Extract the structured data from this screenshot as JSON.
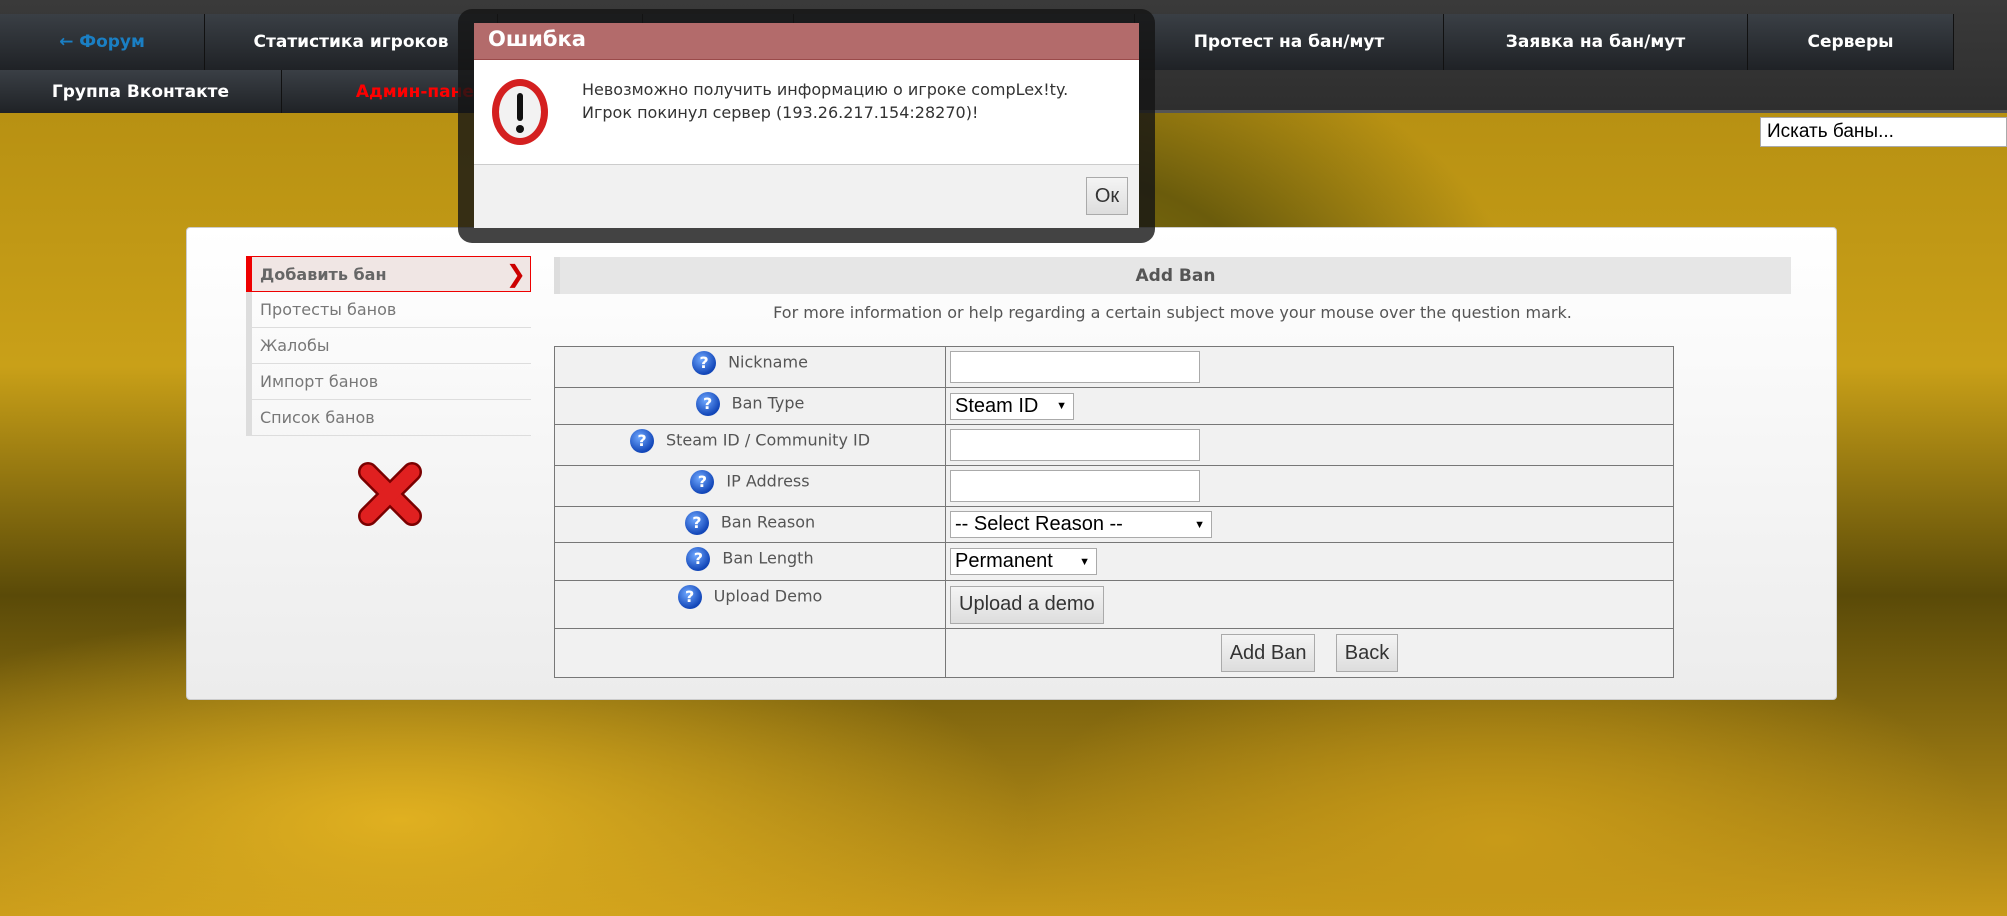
{
  "nav": {
    "row1": [
      {
        "label": "← Форум"
      },
      {
        "label": "Статистика игроков"
      },
      {
        "label": ""
      },
      {
        "label": ""
      },
      {
        "label": ""
      },
      {
        "label": "Протест на бан/мут"
      },
      {
        "label": "Заявка на бан/мут"
      },
      {
        "label": "Серверы"
      }
    ],
    "row2": [
      {
        "label": "Группа Вконтакте"
      },
      {
        "label": "Админ-панель"
      }
    ]
  },
  "search": {
    "placeholder": "Искать баны..."
  },
  "sidebar": {
    "items": [
      {
        "label": "Добавить бан"
      },
      {
        "label": "Протесты банов"
      },
      {
        "label": "Жалобы"
      },
      {
        "label": "Импорт банов"
      },
      {
        "label": "Список банов"
      }
    ]
  },
  "form": {
    "title": "Add Ban",
    "help": "For more information or help regarding a certain subject move your mouse over the question mark.",
    "fields": [
      {
        "label": "Nickname"
      },
      {
        "label": "Ban Type",
        "value": "Steam ID"
      },
      {
        "label": "Steam ID / Community ID"
      },
      {
        "label": "IP Address"
      },
      {
        "label": "Ban Reason",
        "value": "-- Select Reason --"
      },
      {
        "label": "Ban Length",
        "value": "Permanent"
      },
      {
        "label": "Upload Demo",
        "button": "Upload a demo"
      }
    ],
    "submit": "Add Ban",
    "back": "Back"
  },
  "dialog": {
    "title": "Ошибка",
    "line1": "Невозможно получить информацию о игроке compLex!ty.",
    "line2": "Игрок покинул сервер (193.26.217.154:28270)!",
    "ok": "Ок"
  }
}
